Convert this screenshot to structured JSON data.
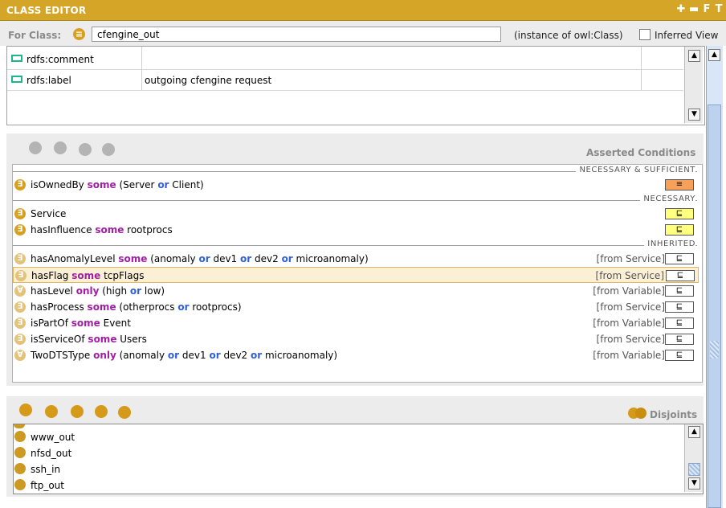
{
  "window": {
    "title": "CLASS EDITOR",
    "title_buttons": [
      "✚",
      "▬",
      "F",
      "T"
    ]
  },
  "for_class": {
    "label": "For Class:",
    "badge_glyph": "≡",
    "class_name": "cfengine_out",
    "instance_of": "(instance of owl:Class)",
    "inferred_label": "Inferred View",
    "inferred_checked": false
  },
  "annotations": [
    {
      "property": "rdfs:comment",
      "value": ""
    },
    {
      "property": "rdfs:label",
      "value": "outgoing cfengine request"
    }
  ],
  "asserted_conditions": {
    "title": "Asserted Conditions",
    "sections": [
      {
        "header": "NECESSARY & SUFFICIENT",
        "rows": [
          {
            "icon": "equivalent-class-icon",
            "relation": "≡",
            "relation_style": "orange",
            "parts": [
              {
                "t": "isOwnedBy ",
                "s": "plain"
              },
              {
                "t": "some",
                "s": "kw"
              },
              {
                "t": " (Server ",
                "s": "plain"
              },
              {
                "t": "or",
                "s": "op"
              },
              {
                "t": " Client)",
                "s": "plain"
              }
            ],
            "from": ""
          }
        ]
      },
      {
        "header": "NECESSARY",
        "rows": [
          {
            "icon": "equivalent-class-icon",
            "relation": "⊑",
            "relation_style": "yellow",
            "parts": [
              {
                "t": "Service",
                "s": "plain"
              }
            ],
            "from": ""
          },
          {
            "icon": "equivalent-class-icon",
            "relation": "⊑",
            "relation_style": "yellow",
            "parts": [
              {
                "t": "hasInfluence ",
                "s": "plain"
              },
              {
                "t": "some",
                "s": "kw"
              },
              {
                "t": " rootprocs",
                "s": "plain"
              }
            ],
            "from": ""
          }
        ]
      },
      {
        "header": "INHERITED",
        "rows": [
          {
            "icon": "existential-icon",
            "relation": "⊑",
            "relation_style": "white",
            "parts": [
              {
                "t": "hasAnomalyLevel ",
                "s": "plain"
              },
              {
                "t": "some",
                "s": "kw"
              },
              {
                "t": " (anomaly ",
                "s": "plain"
              },
              {
                "t": "or",
                "s": "op"
              },
              {
                "t": " dev1 ",
                "s": "plain"
              },
              {
                "t": "or",
                "s": "op"
              },
              {
                "t": " dev2 ",
                "s": "plain"
              },
              {
                "t": "or",
                "s": "op"
              },
              {
                "t": " microanomaly)",
                "s": "plain"
              }
            ],
            "from": "[from Service]"
          },
          {
            "icon": "existential-icon",
            "relation": "⊑",
            "relation_style": "white",
            "selected": true,
            "parts": [
              {
                "t": "hasFlag ",
                "s": "plain"
              },
              {
                "t": "some",
                "s": "kw"
              },
              {
                "t": " tcpFlags",
                "s": "plain"
              }
            ],
            "from": "[from Service]"
          },
          {
            "icon": "universal-icon",
            "relation": "⊑",
            "relation_style": "white",
            "parts": [
              {
                "t": "hasLevel ",
                "s": "plain"
              },
              {
                "t": "only",
                "s": "kw"
              },
              {
                "t": " (high ",
                "s": "plain"
              },
              {
                "t": "or",
                "s": "op"
              },
              {
                "t": " low)",
                "s": "plain"
              }
            ],
            "from": "[from Variable]"
          },
          {
            "icon": "existential-icon",
            "relation": "⊑",
            "relation_style": "white",
            "parts": [
              {
                "t": "hasProcess ",
                "s": "plain"
              },
              {
                "t": "some",
                "s": "kw"
              },
              {
                "t": " (otherprocs ",
                "s": "plain"
              },
              {
                "t": "or",
                "s": "op"
              },
              {
                "t": " rootprocs)",
                "s": "plain"
              }
            ],
            "from": "[from Service]"
          },
          {
            "icon": "existential-icon",
            "relation": "⊑",
            "relation_style": "white",
            "parts": [
              {
                "t": "isPartOf ",
                "s": "plain"
              },
              {
                "t": "some",
                "s": "kw"
              },
              {
                "t": " Event",
                "s": "plain"
              }
            ],
            "from": "[from Variable]"
          },
          {
            "icon": "existential-icon",
            "relation": "⊑",
            "relation_style": "white",
            "parts": [
              {
                "t": "isServiceOf ",
                "s": "plain"
              },
              {
                "t": "some",
                "s": "kw"
              },
              {
                "t": " Users",
                "s": "plain"
              }
            ],
            "from": "[from Service]"
          },
          {
            "icon": "universal-icon",
            "relation": "⊑",
            "relation_style": "white",
            "parts": [
              {
                "t": "TwoDTSType ",
                "s": "plain"
              },
              {
                "t": "only",
                "s": "kw"
              },
              {
                "t": " (anomaly ",
                "s": "plain"
              },
              {
                "t": "or",
                "s": "op"
              },
              {
                "t": " dev1 ",
                "s": "plain"
              },
              {
                "t": "or",
                "s": "op"
              },
              {
                "t": " dev2 ",
                "s": "plain"
              },
              {
                "t": "or",
                "s": "op"
              },
              {
                "t": " microanomaly)",
                "s": "plain"
              }
            ],
            "from": "[from Variable]"
          }
        ]
      }
    ]
  },
  "disjoints": {
    "title": "Disjoints",
    "items": [
      "www_out",
      "nfsd_out",
      "ssh_in",
      "ftp_out"
    ]
  },
  "colors": {
    "title_bar": "#d4a526",
    "class_icon": "#d6a021",
    "keyword": "#a11fa5",
    "operator": "#3060d8",
    "annotation_icon": "#1fb58f"
  }
}
